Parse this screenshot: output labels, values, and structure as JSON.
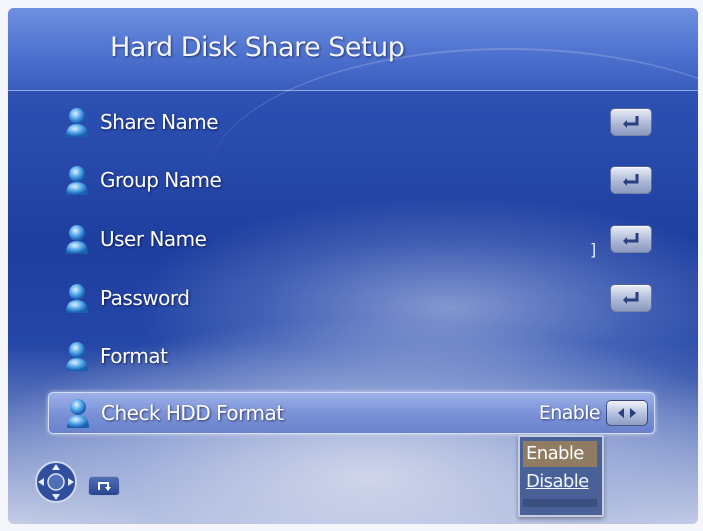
{
  "page": {
    "title": "Hard Disk Share Setup"
  },
  "menu": {
    "items": [
      {
        "label": "Share Name",
        "action_icon": "enter-icon"
      },
      {
        "label": "Group Name",
        "action_icon": "enter-icon"
      },
      {
        "label": "User Name",
        "action_icon": "enter-icon"
      },
      {
        "label": "Password",
        "action_icon": "enter-icon"
      },
      {
        "label": "Format"
      },
      {
        "label": "Check HDD Format",
        "value": "Enable",
        "action_icon": "left-right-icon",
        "selected": true
      }
    ],
    "user_name_value_glyph": "]"
  },
  "dropdown": {
    "options": [
      "Enable",
      "Disable"
    ],
    "highlighted": "Enable"
  },
  "footer": {
    "nav_icon": "dpad-icon",
    "back_icon": "return-icon"
  },
  "colors": {
    "background_top": "#4e72cf",
    "background_mid": "#1f3fa0",
    "highlight_bar": "#7890d6",
    "dropdown_bg": "#4a6198",
    "dropdown_selected": "#8f7c63"
  }
}
